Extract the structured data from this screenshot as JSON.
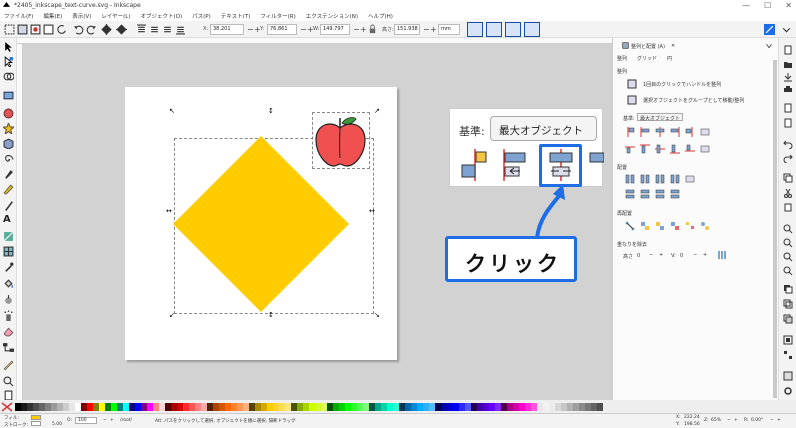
{
  "window": {
    "title": "*2405_inkscape_text-curve.svg - Inkscape",
    "minimize": "—",
    "maximize": "☐",
    "close": "✕"
  },
  "menu": [
    "ファイル(F)",
    "編集(E)",
    "表示(V)",
    "レイヤー(L)",
    "オブジェクト(O)",
    "パス(P)",
    "テキスト(T)",
    "フィルター(R)",
    "エクステンション(N)",
    "ヘルプ(H)"
  ],
  "toolbar": {
    "x_label": "X:",
    "x_value": "38.201",
    "y_label": "Y:",
    "y_value": "76.861",
    "w_label": "W:",
    "w_value": "149.797",
    "h_label": "高さ:",
    "h_value": "151.938",
    "unit": "mm",
    "minus": "−",
    "plus": "+"
  },
  "inset": {
    "basis_label": "基準:",
    "basis_value": "最大オブジェクト",
    "chevron": "⌄"
  },
  "callout": {
    "text": "クリック"
  },
  "panel": {
    "tab_title": "整列と配置 (A)",
    "tab_close": "✕",
    "subtabs": [
      "整列",
      "グリッド",
      "円"
    ],
    "section_align": "整列",
    "option1": "1回目のクリックでハンドルを整列",
    "option2": "選択オブジェクトをグループとして移動/整列",
    "basis_label": "基準:",
    "basis_value": "最大オブジェクト",
    "section_distribute": "配置",
    "section_rearrange": "再配置",
    "section_remove_overlap": "重なりを除去",
    "h_label": "高さ",
    "h_value": "0",
    "v_label": "V:",
    "v_value": "0"
  },
  "status": {
    "fill_label": "フィル:",
    "stroke_label": "ストローク:",
    "stroke_value": "5.00",
    "opacity_label": "O:",
    "opacity_value": "100",
    "layer": "/root/",
    "message": "Alt: パスをクリックして選択, オブジェクトを順に選択, 隔断ドラッグ",
    "x_label": "X:",
    "x_value": "222.24",
    "y_label": "Y:",
    "y_value": "198.56",
    "zoom_label": "Z:",
    "zoom_value": "65%",
    "rot_label": "R:",
    "rot_value": "0.00°"
  },
  "colors": {
    "accent": "#1d6ee6",
    "diamond": "#ffcc00",
    "apple": "#f05050",
    "canvas": "#d2d2d2"
  },
  "palette": [
    "#000000",
    "#1a1a1a",
    "#333333",
    "#4d4d4d",
    "#666666",
    "#808080",
    "#999999",
    "#b3b3b3",
    "#cccccc",
    "#e6e6e6",
    "#ffffff",
    "#800000",
    "#ff0000",
    "#808000",
    "#ffff00",
    "#008000",
    "#00ff00",
    "#008080",
    "#00ffff",
    "#000080",
    "#0000ff",
    "#800080",
    "#ff00ff",
    "#ff8080",
    "#ffd5d5",
    "#550000",
    "#aa0000",
    "#d40000",
    "#ff2a2a",
    "#ff5555",
    "#ff8080",
    "#ffaaaa",
    "#552200",
    "#aa4400",
    "#d45500",
    "#ff6600",
    "#ff7f2a",
    "#ff9955",
    "#ffb380",
    "#554400",
    "#aa8800",
    "#d4aa00",
    "#ffcc00",
    "#ffd42a",
    "#ffdd55",
    "#ffe680",
    "#445500",
    "#88aa00",
    "#aad400",
    "#ccff00",
    "#d4ff2a",
    "#ddff55",
    "#005500",
    "#00aa00",
    "#00d400",
    "#00ff00",
    "#2aff2a",
    "#55ff55",
    "#80ff80",
    "#005544",
    "#00aa88",
    "#00d4aa",
    "#00ffcc",
    "#2affd5",
    "#003355",
    "#0066aa",
    "#0088d4",
    "#00aaff",
    "#2ab0ff",
    "#55bbff",
    "#000055",
    "#0000aa",
    "#0000d4",
    "#0000ff",
    "#2a2aff",
    "#5555ff",
    "#220055",
    "#4400aa",
    "#5500d4",
    "#6600ff",
    "#7f2aff",
    "#550044",
    "#aa0088",
    "#d400aa",
    "#ff00cc",
    "#ff2ad4",
    "#ff55dd",
    "#e6e6e6",
    "#f2f2f2",
    "#ececec",
    "#d8d8d8",
    "#c6c6c6",
    "#b1b1b1",
    "#9d9d9d",
    "#8a8a8a",
    "#767676",
    "#626262",
    "#4e4e4e"
  ]
}
